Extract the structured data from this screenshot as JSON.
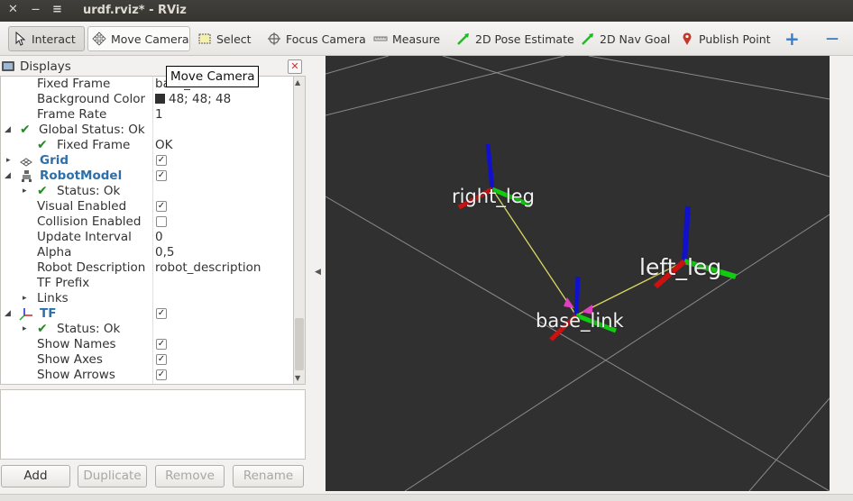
{
  "window": {
    "title": "urdf.rviz* - RViz",
    "close_glyph": "✕",
    "minimize_glyph": "—",
    "menu_glyph": "≡"
  },
  "toolbar": {
    "tools": [
      {
        "key": "interact",
        "label": "Interact",
        "icon": "cursor-icon"
      },
      {
        "key": "move_camera",
        "label": "Move Camera",
        "icon": "move-camera-icon"
      },
      {
        "key": "select",
        "label": "Select",
        "icon": "select-icon"
      },
      {
        "key": "focus_camera",
        "label": "Focus Camera",
        "icon": "crosshair-icon"
      },
      {
        "key": "measure",
        "label": "Measure",
        "icon": "ruler-icon"
      },
      {
        "key": "pose_estimate",
        "label": "2D Pose Estimate",
        "icon": "green-arrow-icon"
      },
      {
        "key": "nav_goal",
        "label": "2D Nav Goal",
        "icon": "green-arrow-icon"
      },
      {
        "key": "publish_point",
        "label": "Publish Point",
        "icon": "map-pin-icon"
      }
    ],
    "add_glyph": "+",
    "remove_glyph": "—"
  },
  "tooltip": "Move Camera",
  "displays": {
    "title": "Displays",
    "close_glyph": "✕",
    "rows": {
      "fixed_frame": {
        "name": "Fixed Frame",
        "value": "base_link"
      },
      "background_color": {
        "name": "Background Color",
        "value": "48; 48; 48"
      },
      "frame_rate": {
        "name": "Frame Rate",
        "value": "1"
      },
      "global_status": {
        "name": "Global Status: Ok"
      },
      "gs_fixed_frame": {
        "name": "Fixed Frame",
        "value": "OK"
      },
      "grid": {
        "name": "Grid",
        "checked": true
      },
      "robot_model": {
        "name": "RobotModel",
        "checked": true
      },
      "rm_status": {
        "name": "Status: Ok"
      },
      "visual_enabled": {
        "name": "Visual Enabled",
        "checked": true
      },
      "collision_enabled": {
        "name": "Collision Enabled",
        "checked": false
      },
      "update_interval": {
        "name": "Update Interval",
        "value": "0"
      },
      "alpha": {
        "name": "Alpha",
        "value": "0,5"
      },
      "robot_description": {
        "name": "Robot Description",
        "value": "robot_description"
      },
      "tf_prefix": {
        "name": "TF Prefix",
        "value": ""
      },
      "links": {
        "name": "Links"
      },
      "tf": {
        "name": "TF",
        "checked": true
      },
      "tf_status": {
        "name": "Status: Ok"
      },
      "show_names": {
        "name": "Show Names",
        "checked": true
      },
      "show_axes": {
        "name": "Show Axes",
        "checked": true
      },
      "show_arrows": {
        "name": "Show Arrows",
        "checked": true
      }
    },
    "check_glyph": "✓",
    "tick_glyph": "✔",
    "expanded_glyph": "◢",
    "collapsed_glyph": "▸",
    "buttons": {
      "add": "Add",
      "duplicate": "Duplicate",
      "remove": "Remove",
      "rename": "Rename"
    }
  },
  "view3d": {
    "background_color": "#303030",
    "frames": [
      {
        "key": "right_leg",
        "label": "right_leg"
      },
      {
        "key": "left_leg",
        "label": "left_leg"
      },
      {
        "key": "base_link",
        "label": "base_link"
      }
    ],
    "axis_colors": {
      "x": "#cc1111",
      "y": "#11cc11",
      "z": "#1111cc"
    },
    "link_line_color": "#d8d860"
  }
}
